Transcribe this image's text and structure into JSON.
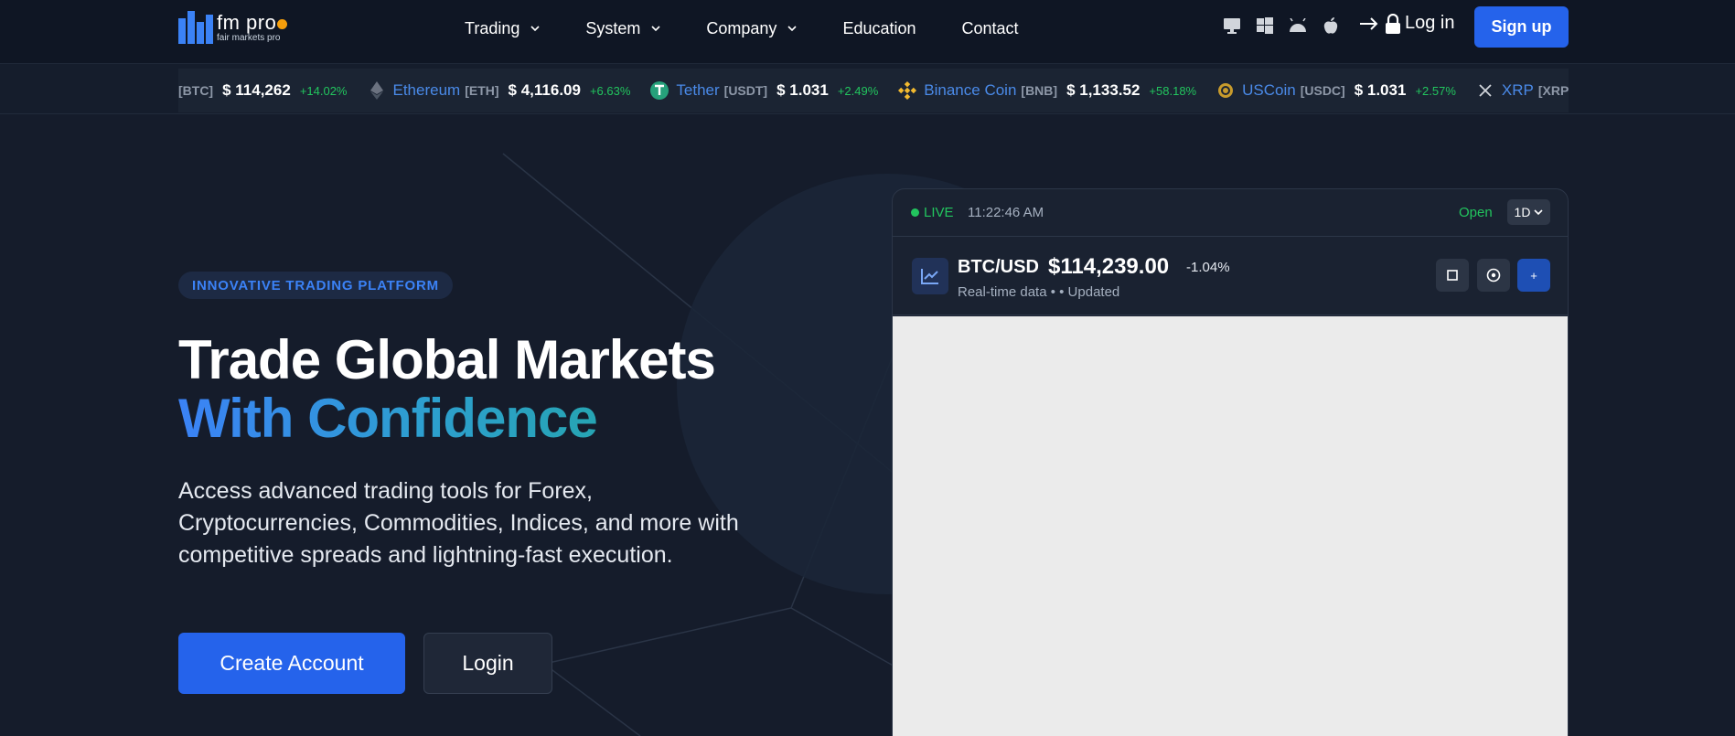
{
  "brand": {
    "name": "fm pro",
    "tagline": "fair markets pro"
  },
  "nav": {
    "items": [
      {
        "label": "Trading",
        "dropdown": true
      },
      {
        "label": "System",
        "dropdown": true
      },
      {
        "label": "Company",
        "dropdown": true
      },
      {
        "label": "Education",
        "dropdown": false
      },
      {
        "label": "Contact",
        "dropdown": false
      }
    ],
    "platforms": [
      "desktop-icon",
      "windows-icon",
      "android-icon",
      "apple-icon"
    ],
    "login_label": "Log in",
    "signup_label": "Sign up"
  },
  "ticker": [
    {
      "name": "",
      "symbol": "[BTC]",
      "price": "$ 114,262",
      "change": "+14.02%"
    },
    {
      "name": "Ethereum",
      "symbol": "[ETH]",
      "price": "$ 4,116.09",
      "change": "+6.63%",
      "icon": "ethereum-icon"
    },
    {
      "name": "Tether",
      "symbol": "[USDT]",
      "price": "$ 1.031",
      "change": "+2.49%",
      "icon": "tether-icon"
    },
    {
      "name": "Binance Coin",
      "symbol": "[BNB]",
      "price": "$ 1,133.52",
      "change": "+58.18%",
      "icon": "binance-icon"
    },
    {
      "name": "USCoin",
      "symbol": "[USDC]",
      "price": "$ 1.031",
      "change": "+2.57%",
      "icon": "usdcoin-icon"
    },
    {
      "name": "XRP",
      "symbol": "[XRP]",
      "price": "",
      "change": "",
      "icon": "xrp-icon"
    }
  ],
  "hero": {
    "badge": "INNOVATIVE TRADING PLATFORM",
    "title_line1": "Trade Global Markets",
    "title_line2": "With Confidence",
    "lead": "Access advanced trading tools for Forex, Cryptocurrencies, Commodities, Indices, and more with competitive spreads and lightning-fast execution.",
    "cta_primary": "Create Account",
    "cta_secondary": "Login"
  },
  "widget": {
    "live_label": "LIVE",
    "time": "11:22:46 AM",
    "market_status": "Open",
    "timeframe": "1D",
    "pair": "BTC/USD",
    "price": "$114,239.00",
    "change": "-1.04%",
    "subtitle": "Real-time data •  • Updated",
    "buttons": [
      "square-icon",
      "target-icon",
      "plus-icon"
    ],
    "plus_label": "+"
  },
  "colors": {
    "background": "#151c2b",
    "accent": "#2563eb",
    "positive": "#22c55e",
    "brand_dot": "#f59e0b"
  }
}
